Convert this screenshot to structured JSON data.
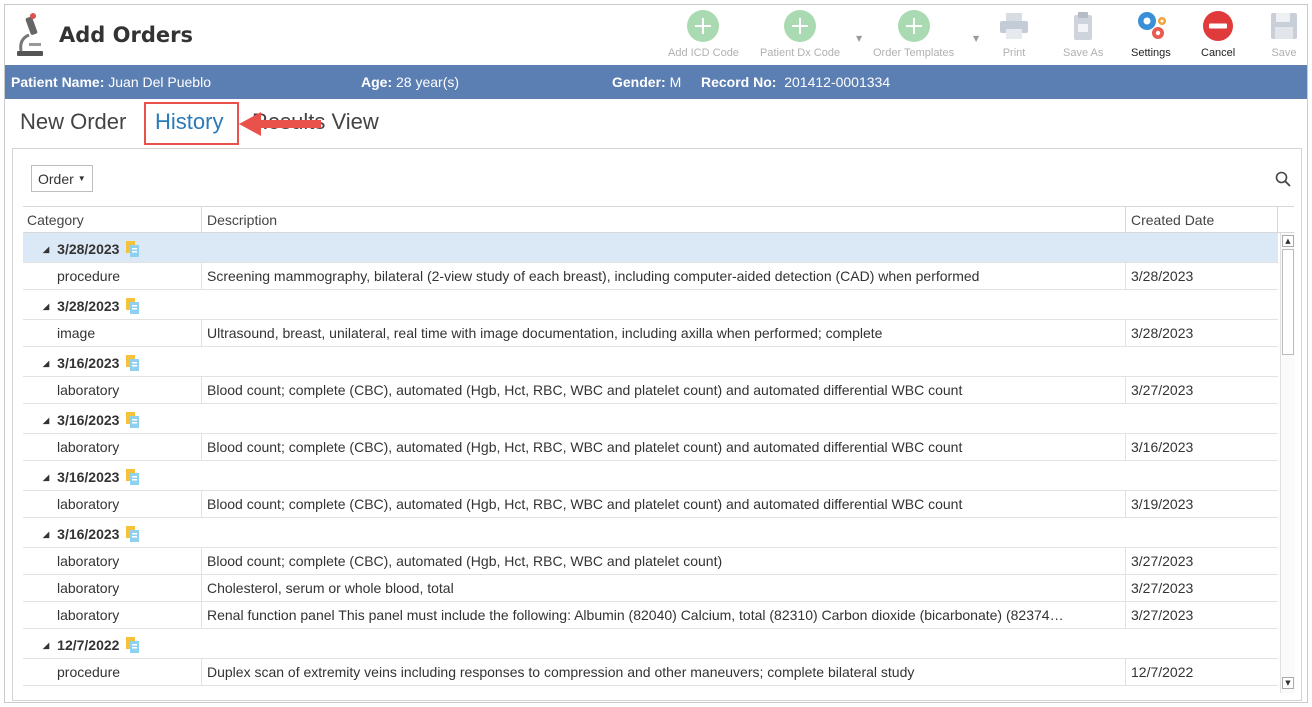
{
  "window": {
    "title": "Add Orders"
  },
  "toolbar": {
    "buttons": [
      {
        "label": "Add ICD Code",
        "icon": "plus-circle-icon",
        "enabled": false
      },
      {
        "label": "Patient Dx Code",
        "icon": "plus-circle-icon",
        "enabled": false
      },
      {
        "label": "Order Templates",
        "icon": "plus-circle-icon",
        "enabled": false
      },
      {
        "label": "Print",
        "icon": "printer-icon",
        "enabled": false
      },
      {
        "label": "Save As",
        "icon": "clipboard-icon",
        "enabled": false
      },
      {
        "label": "Settings",
        "icon": "gears-icon",
        "enabled": true
      },
      {
        "label": "Cancel",
        "icon": "cancel-icon",
        "enabled": true
      },
      {
        "label": "Save",
        "icon": "floppy-icon",
        "enabled": false
      }
    ]
  },
  "patient": {
    "name_label": "Patient Name:",
    "name_value": "Juan Del Pueblo",
    "age_label": "Age:",
    "age_value": "28 year(s)",
    "gender_label": "Gender:",
    "gender_value": "M",
    "record_label": "Record No:",
    "record_value": "201412-0001334"
  },
  "tabs": [
    {
      "label": "New Order",
      "active": false
    },
    {
      "label": "History",
      "active": true
    },
    {
      "label": "Results View",
      "active": false
    }
  ],
  "grid": {
    "groupby_label": "Order",
    "columns": [
      "Category",
      "Description",
      "Created Date"
    ],
    "groups": [
      {
        "date": "3/28/2023",
        "selected": true,
        "rows": [
          {
            "category": "procedure",
            "description": "Screening mammography, bilateral (2-view study of each breast), including computer-aided detection (CAD) when performed",
            "created": "3/28/2023"
          }
        ]
      },
      {
        "date": "3/28/2023",
        "selected": false,
        "rows": [
          {
            "category": "image",
            "description": "Ultrasound, breast, unilateral, real time with image documentation, including axilla when performed; complete",
            "created": "3/28/2023"
          }
        ]
      },
      {
        "date": "3/16/2023",
        "selected": false,
        "rows": [
          {
            "category": "laboratory",
            "description": "Blood count; complete (CBC), automated (Hgb, Hct, RBC, WBC and platelet count) and automated differential WBC count",
            "created": "3/27/2023"
          }
        ]
      },
      {
        "date": "3/16/2023",
        "selected": false,
        "rows": [
          {
            "category": "laboratory",
            "description": "Blood count; complete (CBC), automated (Hgb, Hct, RBC, WBC and platelet count) and automated differential WBC count",
            "created": "3/16/2023"
          }
        ]
      },
      {
        "date": "3/16/2023",
        "selected": false,
        "rows": [
          {
            "category": "laboratory",
            "description": "Blood count; complete (CBC), automated (Hgb, Hct, RBC, WBC and platelet count) and automated differential WBC count",
            "created": "3/19/2023"
          }
        ]
      },
      {
        "date": "3/16/2023",
        "selected": false,
        "rows": [
          {
            "category": "laboratory",
            "description": "Blood count; complete (CBC), automated (Hgb, Hct, RBC, WBC and platelet count)",
            "created": "3/27/2023"
          },
          {
            "category": "laboratory",
            "description": "Cholesterol, serum or whole blood, total",
            "created": "3/27/2023"
          },
          {
            "category": "laboratory",
            "description": "Renal function panel This panel must include the following: Albumin (82040) Calcium, total (82310) Carbon dioxide (bicarbonate) (82374…",
            "created": "3/27/2023"
          }
        ]
      },
      {
        "date": "12/7/2022",
        "selected": false,
        "rows": [
          {
            "category": "procedure",
            "description": "Duplex scan of extremity veins including responses to compression and other maneuvers; complete bilateral study",
            "created": "12/7/2022"
          }
        ]
      }
    ]
  },
  "colors": {
    "patient_bar": "#5b7fb2",
    "active_tab": "#2a7ab8",
    "highlight": "#e8524a",
    "selected_row": "#dbe8f5"
  }
}
